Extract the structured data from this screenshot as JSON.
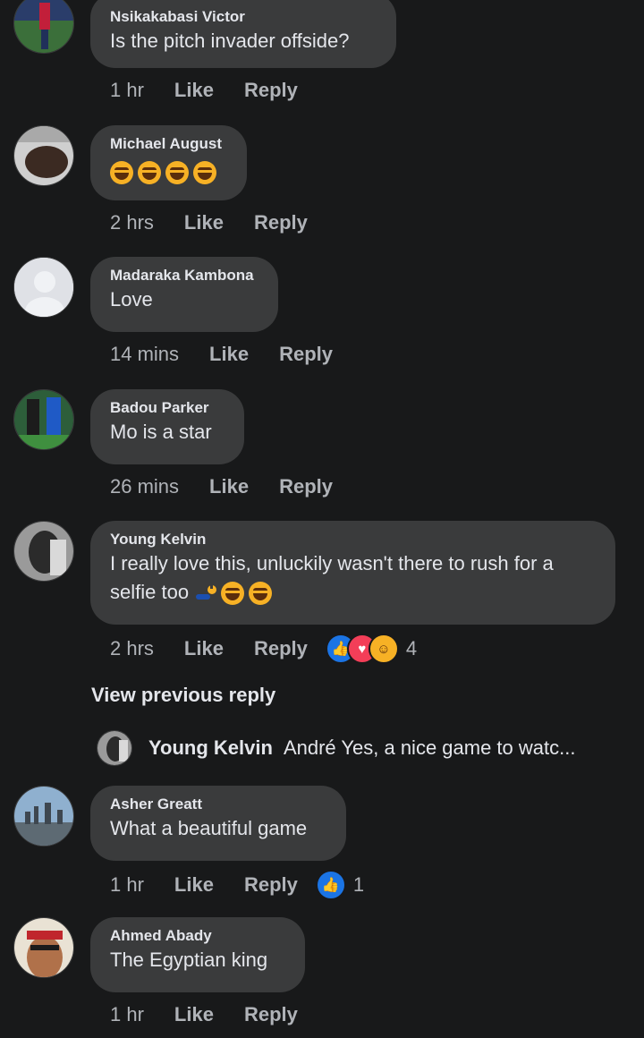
{
  "comments": [
    {
      "author": "Nsikakabasi Victor",
      "text": "Is the pitch invader offside?",
      "time": "1 hr",
      "like": "Like",
      "reply": "Reply"
    },
    {
      "author": "Michael August",
      "time": "2 hrs",
      "like": "Like",
      "reply": "Reply"
    },
    {
      "author": "Madaraka Kambona",
      "text": "Love",
      "time": "14 mins",
      "like": "Like",
      "reply": "Reply"
    },
    {
      "author": "Badou Parker",
      "text": "Mo is a star",
      "time": "26 mins",
      "like": "Like",
      "reply": "Reply"
    },
    {
      "author": "Young Kelvin",
      "text_line1": "I really love this, unluckily wasn't there to rush for a",
      "text_line2": "selfie too",
      "time": "2 hrs",
      "like": "Like",
      "reply": "Reply",
      "reaction_count": "4"
    },
    {
      "author": "Asher Greatt",
      "text": "What a beautiful game",
      "time": "1 hr",
      "like": "Like",
      "reply": "Reply",
      "reaction_count": "1"
    },
    {
      "author": "Ahmed Abady",
      "text": "The Egyptian king",
      "time": "1 hr",
      "like": "Like",
      "reply": "Reply"
    }
  ],
  "view_previous_reply": "View previous reply",
  "reply_preview": {
    "author": "Young Kelvin",
    "text": "André Yes, a nice game to watc..."
  },
  "icons": {
    "laugh": "laughing-emoji-icon",
    "like": "like-reaction-icon",
    "love": "love-reaction-icon",
    "haha": "haha-reaction-icon",
    "selfie": "selfie-emoji-icon"
  },
  "colors": {
    "background": "#18191a",
    "bubble": "#3a3b3c",
    "like_blue": "#1b74e4",
    "love_red": "#f33e58",
    "haha_yellow": "#f7b125"
  }
}
